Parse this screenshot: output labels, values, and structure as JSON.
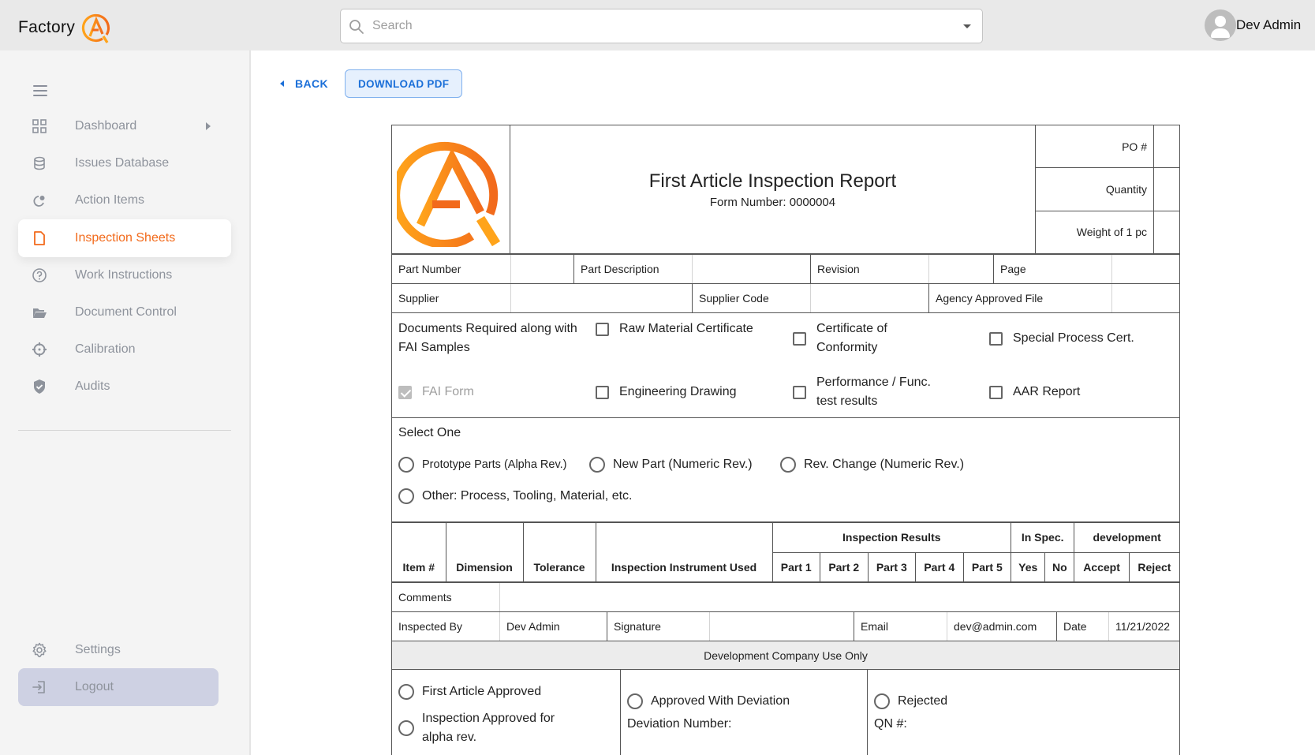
{
  "app": {
    "brand_name": "Factory",
    "brand_colors": {
      "primary": "#f7941d",
      "accent": "#f26a1b"
    }
  },
  "search": {
    "placeholder": "Search",
    "value": ""
  },
  "user": {
    "name": "Dev Admin"
  },
  "sidebar": {
    "items": [
      {
        "label": "Dashboard",
        "icon": "grid-icon",
        "has_submenu": true
      },
      {
        "label": "Issues Database",
        "icon": "database-icon"
      },
      {
        "label": "Action Items",
        "icon": "pie-chart-icon"
      },
      {
        "label": "Inspection Sheets",
        "icon": "file-icon",
        "active": true
      },
      {
        "label": "Work Instructions",
        "icon": "help-circle-icon"
      },
      {
        "label": "Document Control",
        "icon": "folder-open-icon"
      },
      {
        "label": "Calibration",
        "icon": "crosshair-icon"
      },
      {
        "label": "Audits",
        "icon": "shield-check-icon"
      }
    ],
    "bottom": [
      {
        "label": "Settings",
        "icon": "gear-icon"
      },
      {
        "label": "Logout",
        "icon": "logout-icon"
      }
    ]
  },
  "toolbar": {
    "back_label": "BACK",
    "download_label": "DOWNLOAD PDF"
  },
  "form": {
    "title": "First Article Inspection Report",
    "form_number": "Form Number: 0000004",
    "header_fields": [
      {
        "label": "PO #",
        "value": ""
      },
      {
        "label": "Quantity",
        "value": ""
      },
      {
        "label": "Weight of 1 pc",
        "value": ""
      }
    ],
    "row1": [
      {
        "label": "Part Number",
        "value": ""
      },
      {
        "label": "Part Description",
        "value": ""
      },
      {
        "label": "Revision",
        "value": ""
      },
      {
        "label": "Page",
        "value": ""
      }
    ],
    "row2": [
      {
        "label": "Supplier",
        "value": ""
      },
      {
        "label": "Supplier Code",
        "value": ""
      },
      {
        "label": "Agency Approved File",
        "value": ""
      }
    ],
    "docs_required": {
      "label": "Documents Required along with FAI Samples",
      "items": [
        {
          "label": "Raw Material Certificate",
          "checked": false
        },
        {
          "label": "Certificate of Conformity",
          "checked": false
        },
        {
          "label": "Special Process Cert.",
          "checked": false
        },
        {
          "label": "FAI Form",
          "checked": true,
          "disabled": true
        },
        {
          "label": "Engineering Drawing",
          "checked": false
        },
        {
          "label": "Performance / Func. test results",
          "checked": false
        },
        {
          "label": "AAR Report",
          "checked": false
        }
      ]
    },
    "select_one": {
      "title": "Select One",
      "options": [
        {
          "label": "Prototype Parts (Alpha Rev.)",
          "selected": false
        },
        {
          "label": "New Part (Numeric Rev.)",
          "selected": false
        },
        {
          "label": "Rev. Change (Numeric Rev.)",
          "selected": false
        },
        {
          "label": "Other: Process, Tooling, Material, etc.",
          "selected": false
        }
      ]
    },
    "results_table": {
      "group_headers": {
        "inspection_results": "Inspection Results",
        "in_spec": "In Spec.",
        "development": "development"
      },
      "columns": [
        "Item #",
        "Dimension",
        "Tolerance",
        "Inspection Instrument Used",
        "Part 1",
        "Part 2",
        "Part 3",
        "Part 4",
        "Part 5",
        "Yes",
        "No",
        "Accept",
        "Reject"
      ],
      "rows": []
    },
    "comments": {
      "label": "Comments",
      "value": ""
    },
    "inspected": {
      "inspected_by_label": "Inspected By",
      "inspected_by": "Dev Admin",
      "signature_label": "Signature",
      "signature": "",
      "email_label": "Email",
      "email": "dev@admin.com",
      "date_label": "Date",
      "date": "11/21/2022"
    },
    "dev_use_only": "Development Company Use Only",
    "approval": {
      "first_article_approved": "First Article Approved",
      "inspection_approved_alpha": "Inspection Approved for alpha rev.",
      "approved_with_deviation": "Approved With Deviation",
      "deviation_number_label": "Deviation Number:",
      "rejected": "Rejected",
      "qn_label": "QN #:"
    }
  }
}
